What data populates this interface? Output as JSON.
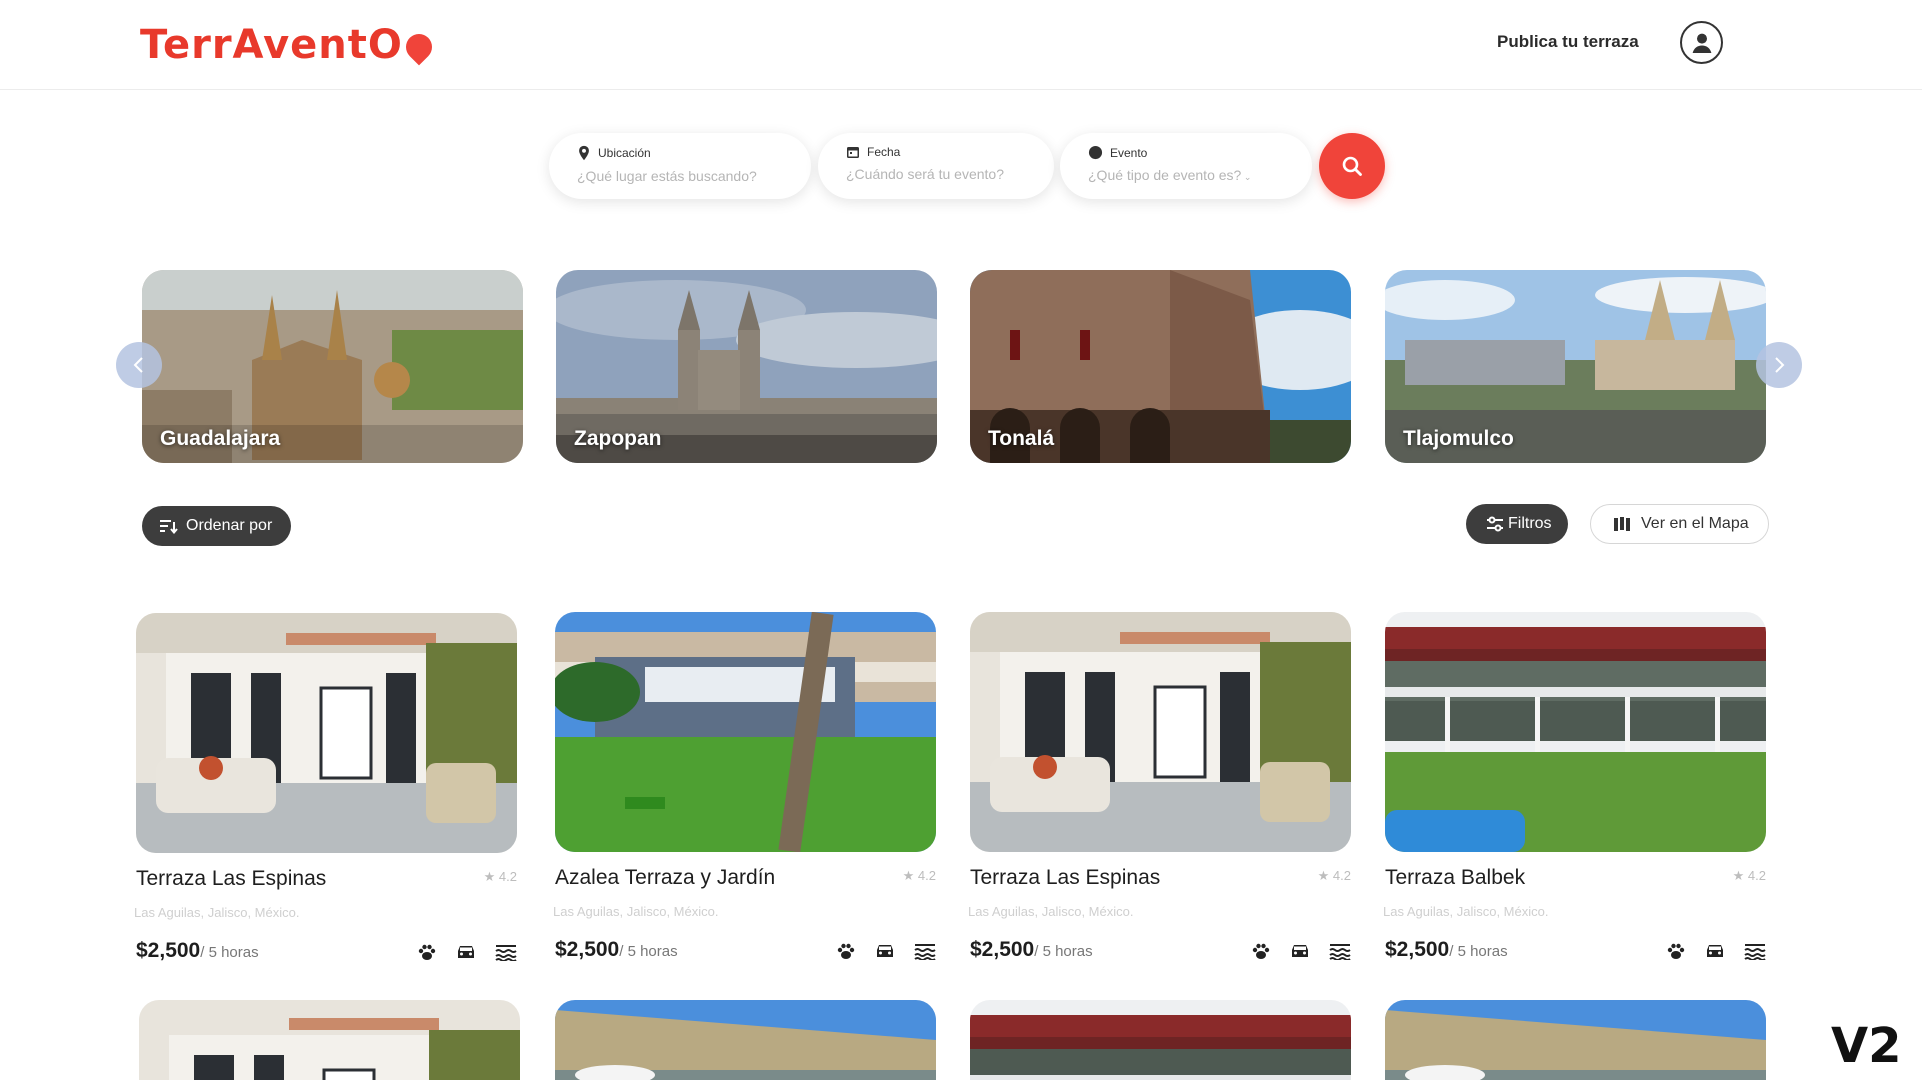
{
  "brand": {
    "name": "TerrAventO",
    "accent": "#f0443a"
  },
  "header": {
    "publish_label": "Publica tu terraza",
    "user_icon": "user-icon"
  },
  "search": {
    "location": {
      "label": "Ubicación",
      "placeholder": "¿Qué lugar estás buscando?",
      "icon": "pin-icon"
    },
    "date": {
      "label": "Fecha",
      "placeholder": "¿Cuándo será tu evento?",
      "icon": "calendar-icon"
    },
    "event": {
      "label": "Evento",
      "placeholder": "¿Qué tipo de evento es?",
      "icon": "event-icon"
    },
    "button_icon": "search-icon"
  },
  "cities": [
    {
      "name": "Guadalajara"
    },
    {
      "name": "Zapopan"
    },
    {
      "name": "Tonalá"
    },
    {
      "name": "Tlajomulco"
    }
  ],
  "controls": {
    "sort_label": "Ordenar por",
    "filters_label": "Filtros",
    "map_label": "Ver en el Mapa"
  },
  "listings": [
    {
      "title": "Terraza Las Espinas",
      "rating": "4.2",
      "location": "Las Aguilas, Jalisco, México.",
      "price": "$2,500",
      "per": "/ 5 horas"
    },
    {
      "title": "Azalea Terraza y Jardín",
      "rating": "4.2",
      "location": "Las Aguilas, Jalisco, México.",
      "price": "$2,500",
      "per": "/ 5 horas"
    },
    {
      "title": "Terraza Las Espinas",
      "rating": "4.2",
      "location": "Las Aguilas, Jalisco, México.",
      "price": "$2,500",
      "per": "/ 5 horas"
    },
    {
      "title": "Terraza Balbek",
      "rating": "4.2",
      "location": "Las Aguilas, Jalisco, México.",
      "price": "$2,500",
      "per": "/ 5 horas"
    }
  ],
  "amenities": [
    "paw-icon",
    "car-icon",
    "pool-icon"
  ],
  "version_label": "V2"
}
